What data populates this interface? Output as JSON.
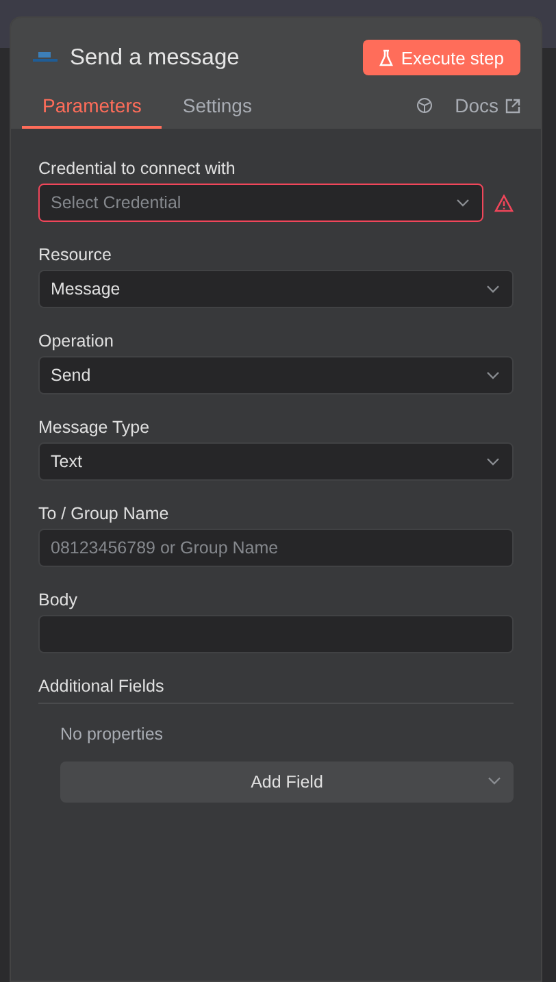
{
  "header": {
    "title": "Send a message",
    "execute_button": "Execute step"
  },
  "tabs": [
    {
      "label": "Parameters",
      "selected": true
    },
    {
      "label": "Settings",
      "selected": false
    }
  ],
  "docs_link": "Docs",
  "fields": [
    {
      "kind": "select",
      "label": "Credential to connect with",
      "placeholder": "Select Credential",
      "error": true
    },
    {
      "kind": "select",
      "label": "Resource",
      "value": "Message",
      "error": false
    },
    {
      "kind": "select",
      "label": "Operation",
      "value": "Send",
      "error": false
    },
    {
      "kind": "select",
      "label": "Message Type",
      "value": "Text",
      "error": false
    },
    {
      "kind": "text",
      "label": "To / Group Name",
      "placeholder": "08123456789 or Group Name",
      "error": false
    },
    {
      "kind": "text",
      "label": "Body",
      "error": false
    }
  ],
  "additional_fields": {
    "title": "Additional Fields",
    "empty_text": "No properties",
    "add_button": "Add Field"
  }
}
